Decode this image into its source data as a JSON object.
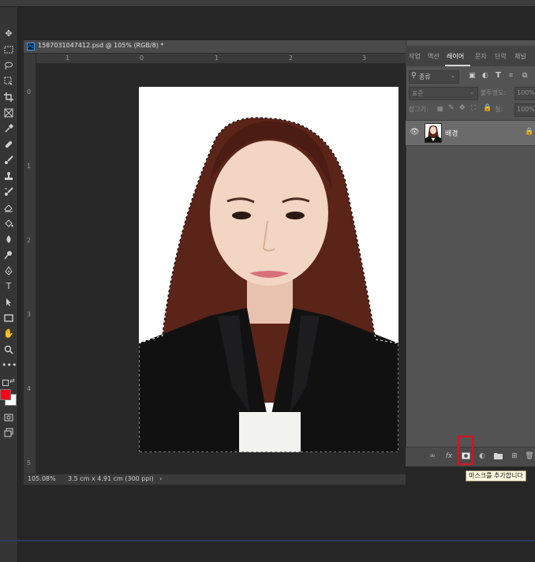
{
  "document": {
    "tab_title": "1587031047412.psd @ 105% (RGB/8) *",
    "ps_badge": "Ps"
  },
  "rulers": {
    "horizontal": [
      "1",
      "0",
      "1",
      "2",
      "3"
    ],
    "vertical": [
      "0",
      "1",
      "2",
      "3",
      "4",
      "5"
    ]
  },
  "status": {
    "zoom": "105.08%",
    "dimensions": "3.5 cm x 4.91 cm (300 ppi)",
    "arrow": "›"
  },
  "panel": {
    "tabs": [
      "작업",
      "액션",
      "레이어",
      "문자",
      "단락",
      "채널"
    ],
    "active_tab": "레이어",
    "filter_kind": "종류",
    "blend_mode": "표준",
    "opacity_label": "불투명도:",
    "opacity_value": "100%",
    "lock_label": "잠그기:",
    "fill_label": "칠:",
    "fill_value": "100%",
    "layers": [
      {
        "name": "배경",
        "visible": true,
        "locked": true
      }
    ]
  },
  "tooltip": "마스크를 추가합니다",
  "colors": {
    "foreground": "#ff0015",
    "background": "#ffffff",
    "highlight": "#e0101a"
  }
}
